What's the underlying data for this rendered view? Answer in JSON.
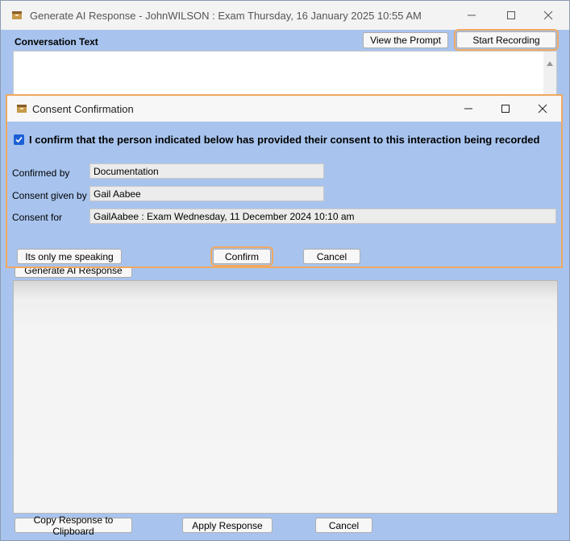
{
  "main_window": {
    "title": "Generate AI Response - JohnWILSON : Exam Thursday, 16 January 2025 10:55 AM",
    "conversation_label": "Conversation Text",
    "view_prompt_button": "View the Prompt",
    "start_recording_button": "Start Recording",
    "generate_button": "Generate AI Response",
    "copy_button": "Copy Response to Clipboard",
    "apply_button": "Apply Response",
    "cancel_button": "Cancel"
  },
  "dialog": {
    "title": "Consent Confirmation",
    "confirm_text": "I confirm that the person indicated below has provided their consent to this interaction being recorded",
    "checkbox_checked": true,
    "fields": {
      "confirmed_by_label": "Confirmed by",
      "confirmed_by_value": "Documentation",
      "consent_given_by_label": "Consent given by",
      "consent_given_by_value": "Gail Aabee",
      "consent_for_label": "Consent for",
      "consent_for_value": "GailAabee : Exam Wednesday, 11 December 2024 10:10 am"
    },
    "only_me_button": "Its only me speaking",
    "confirm_button": "Confirm",
    "cancel_button": "Cancel"
  },
  "colors": {
    "client_bg": "#a8c4ee",
    "focus_accent": "#f0a860",
    "check_blue": "#1d5fd6"
  },
  "icons": {
    "app_icon": "app-box-icon",
    "minimize": "minimize-icon",
    "maximize": "maximize-icon",
    "close": "close-icon",
    "scroll_up": "scroll-up-arrow-icon",
    "check": "check-icon"
  }
}
